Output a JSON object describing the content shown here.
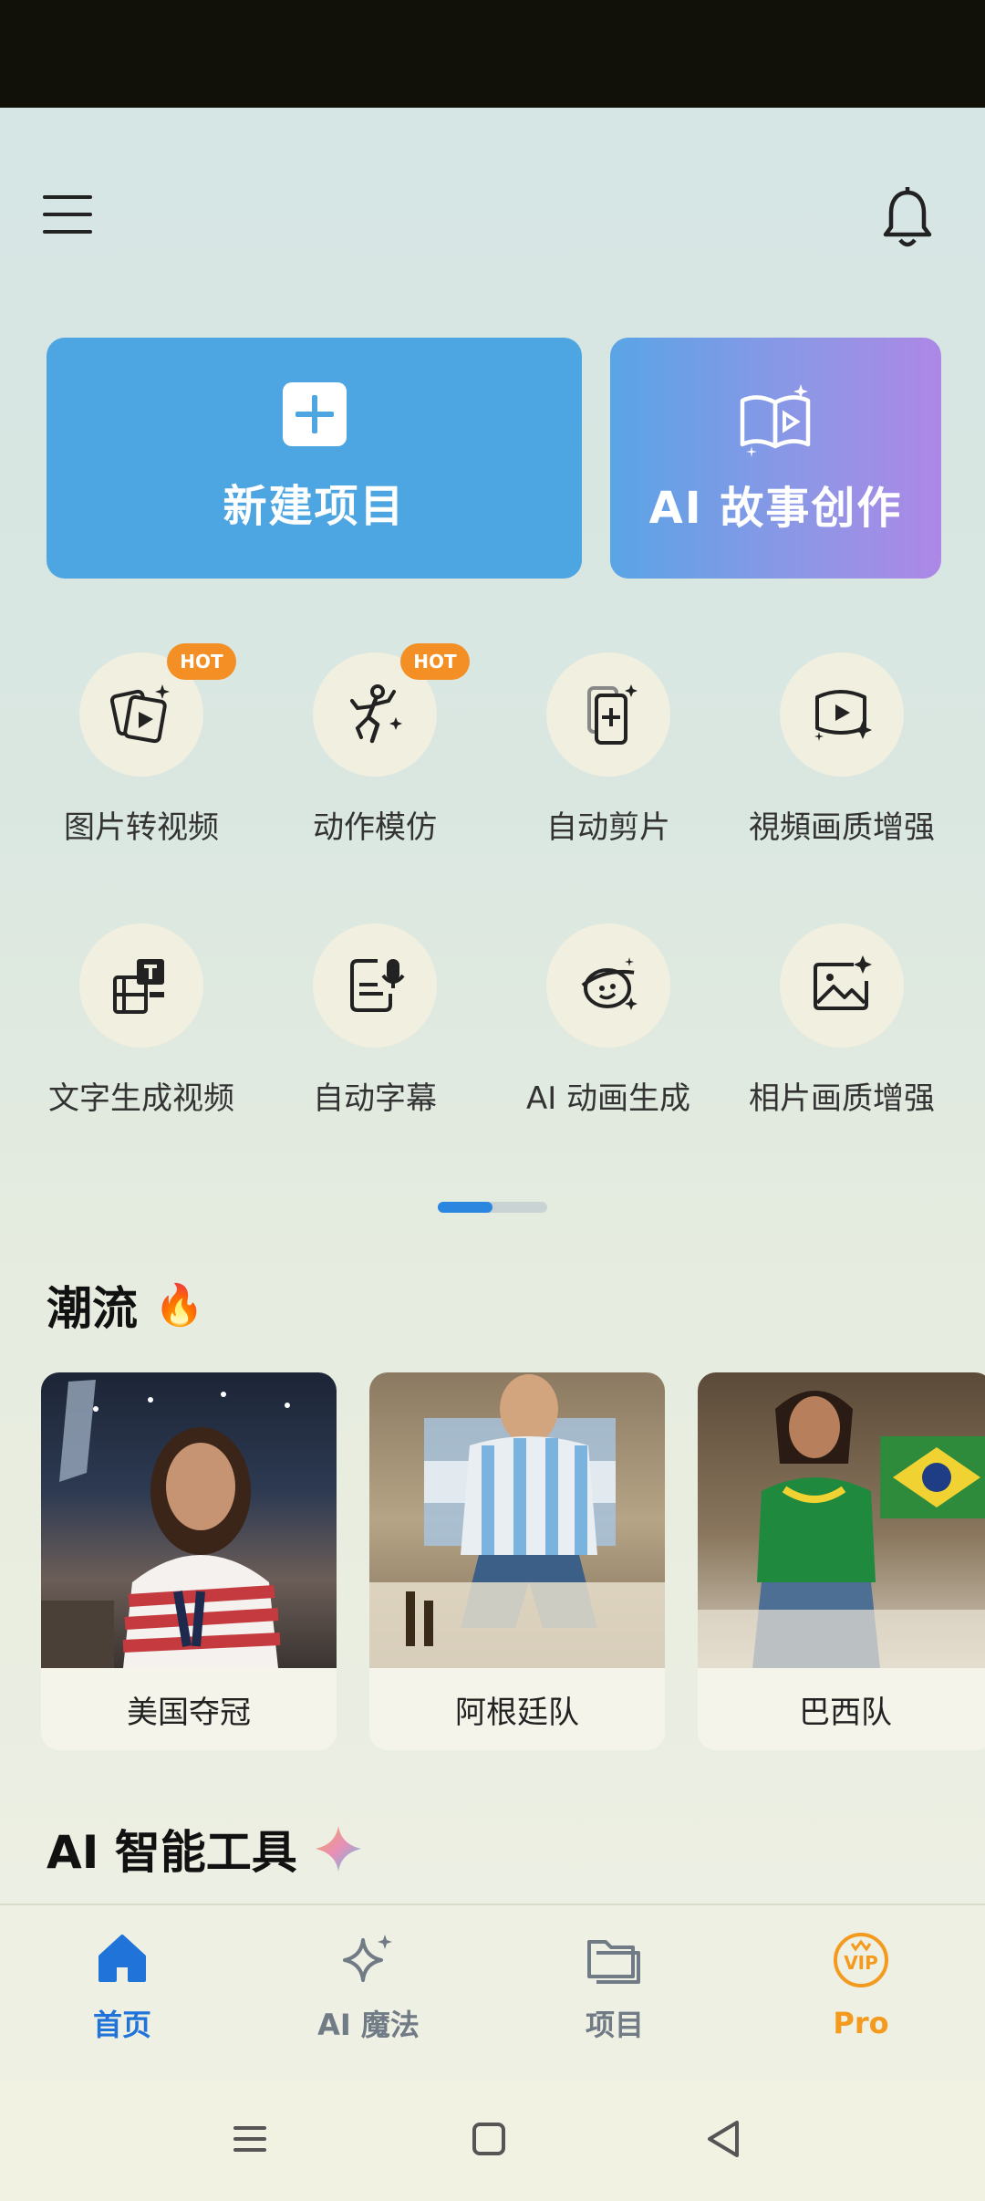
{
  "top_bar": {
    "menu_icon": "menu-icon",
    "bell_icon": "bell-icon"
  },
  "cards": {
    "new_project": {
      "label": "新建项目",
      "icon": "plus-icon"
    },
    "ai_story": {
      "label": "AI 故事创作",
      "icon": "book-play-icon"
    }
  },
  "tools": [
    {
      "label": "图片转视频",
      "badge": "HOT",
      "icon": "image-to-video-icon"
    },
    {
      "label": "动作模仿",
      "badge": "HOT",
      "icon": "dance-icon"
    },
    {
      "label": "自动剪片",
      "badge": "",
      "icon": "auto-cut-icon"
    },
    {
      "label": "視頻画质增强",
      "badge": "",
      "icon": "video-enhance-icon"
    },
    {
      "label": "文字生成视频",
      "badge": "",
      "icon": "text-to-video-icon"
    },
    {
      "label": "自动字幕",
      "badge": "",
      "icon": "subtitle-icon"
    },
    {
      "label": "AI 动画生成",
      "badge": "",
      "icon": "ai-animation-icon"
    },
    {
      "label": "相片画质增强",
      "badge": "",
      "icon": "photo-enhance-icon"
    }
  ],
  "pager": {
    "active_fraction": 0.5
  },
  "trends_section": {
    "title": "潮流",
    "emoji": "🔥"
  },
  "trends": [
    {
      "name": "美国夺冠"
    },
    {
      "name": "阿根廷队"
    },
    {
      "name": "巴西队"
    }
  ],
  "ai_tools_section": {
    "title": "AI 智能工具",
    "icon": "sparkle-icon"
  },
  "bottom_nav": [
    {
      "label": "首页",
      "icon": "home-icon",
      "active": true,
      "color": "#1f73d9"
    },
    {
      "label": "AI 魔法",
      "icon": "magic-icon",
      "active": false,
      "color": "#717b86"
    },
    {
      "label": "项目",
      "icon": "folder-icon",
      "active": false,
      "color": "#717b86"
    },
    {
      "label": "Pro",
      "icon": "vip-icon",
      "active": false,
      "color": "#f39a1f"
    }
  ],
  "system_nav": {
    "menu": "recents-icon",
    "home": "home-square-icon",
    "back": "back-triangle-icon"
  }
}
